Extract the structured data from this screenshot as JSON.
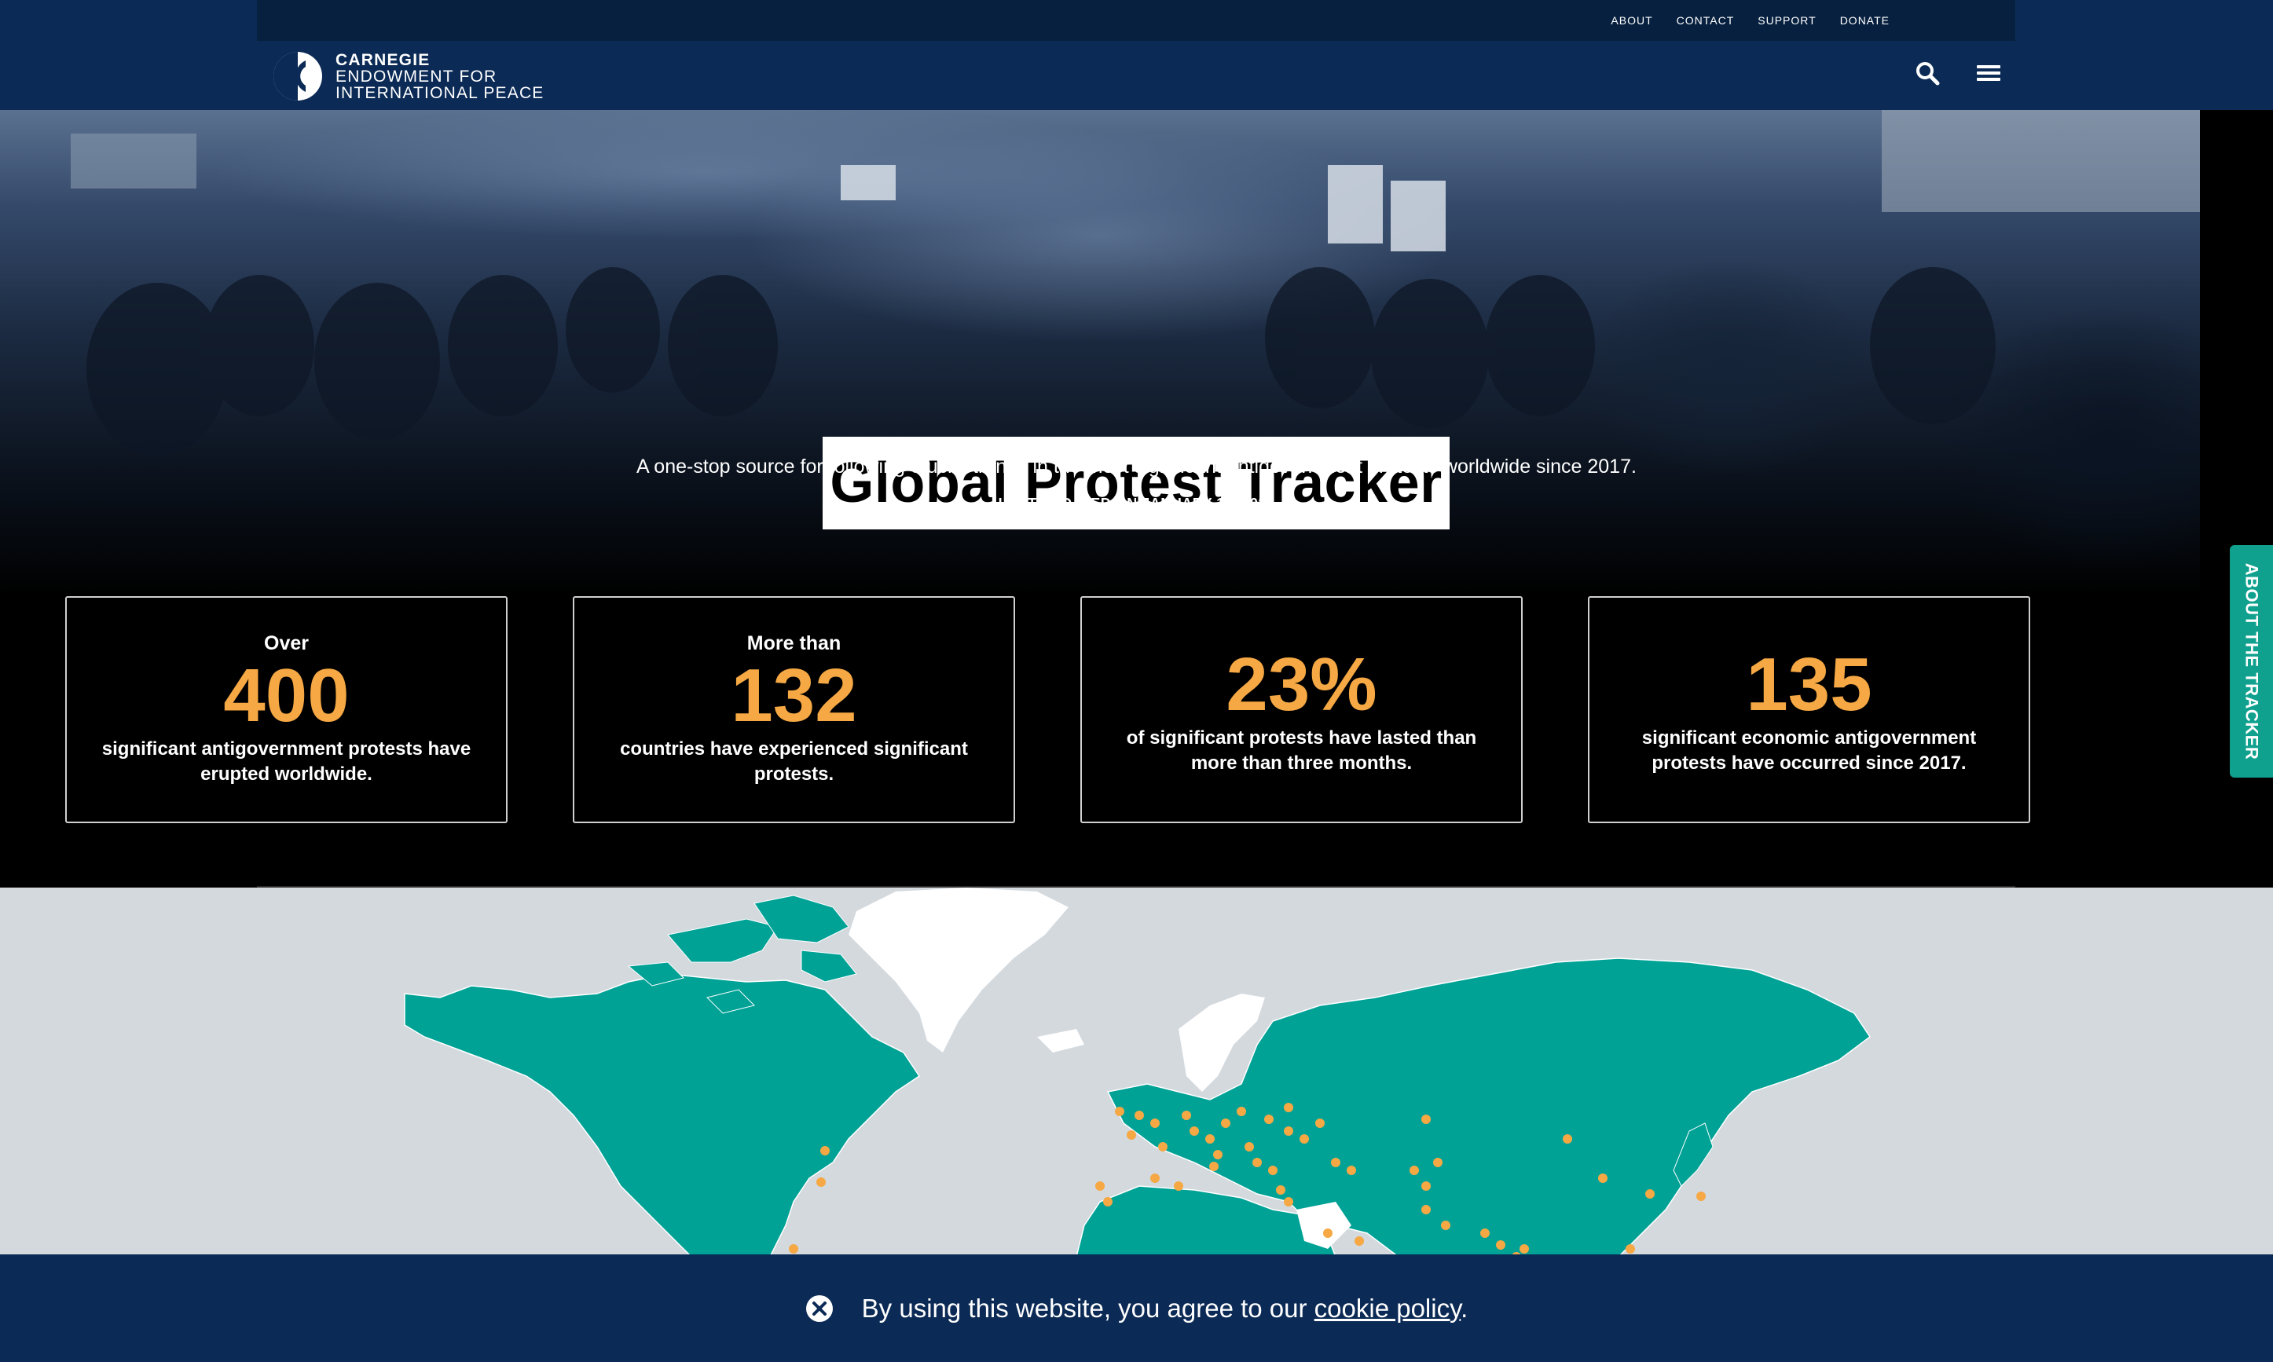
{
  "header": {
    "utility_nav": [
      "ABOUT",
      "CONTACT",
      "SUPPORT",
      "DONATE"
    ],
    "logo": {
      "line1": "CARNEGIE",
      "line2": "ENDOWMENT FOR",
      "line3": "INTERNATIONAL PEACE"
    }
  },
  "hero": {
    "title": "Global Protest Tracker",
    "subtitle": "A one-stop source for following crucial trends in the most significant antigovernment protests worldwide since 2017.",
    "updated": "LAST UPDATED ON JANUARY 10, 2023"
  },
  "stats": [
    {
      "pre": "Over",
      "number": "400",
      "desc": "significant antigovernment protests have erupted worldwide."
    },
    {
      "pre": "More than",
      "number": "132",
      "desc": "countries have experienced significant protests."
    },
    {
      "pre": "",
      "number": "23%",
      "desc": "of significant protests have lasted than more than three months."
    },
    {
      "pre": "",
      "number": "135",
      "desc": "significant economic antigovernment protests have occurred since 2017."
    }
  ],
  "side_tab": "ABOUT THE TRACKER",
  "cookie": {
    "text": "By using this website, you agree to our ",
    "link": "cookie policy",
    "end": "."
  },
  "colors": {
    "navy": "#0b2a55",
    "accent": "#f5a843",
    "teal": "#0fa08e",
    "map_land": "#00a296",
    "map_sea": "#d4d9de"
  },
  "icons": [
    "search-icon",
    "menu-icon",
    "close-icon"
  ]
}
